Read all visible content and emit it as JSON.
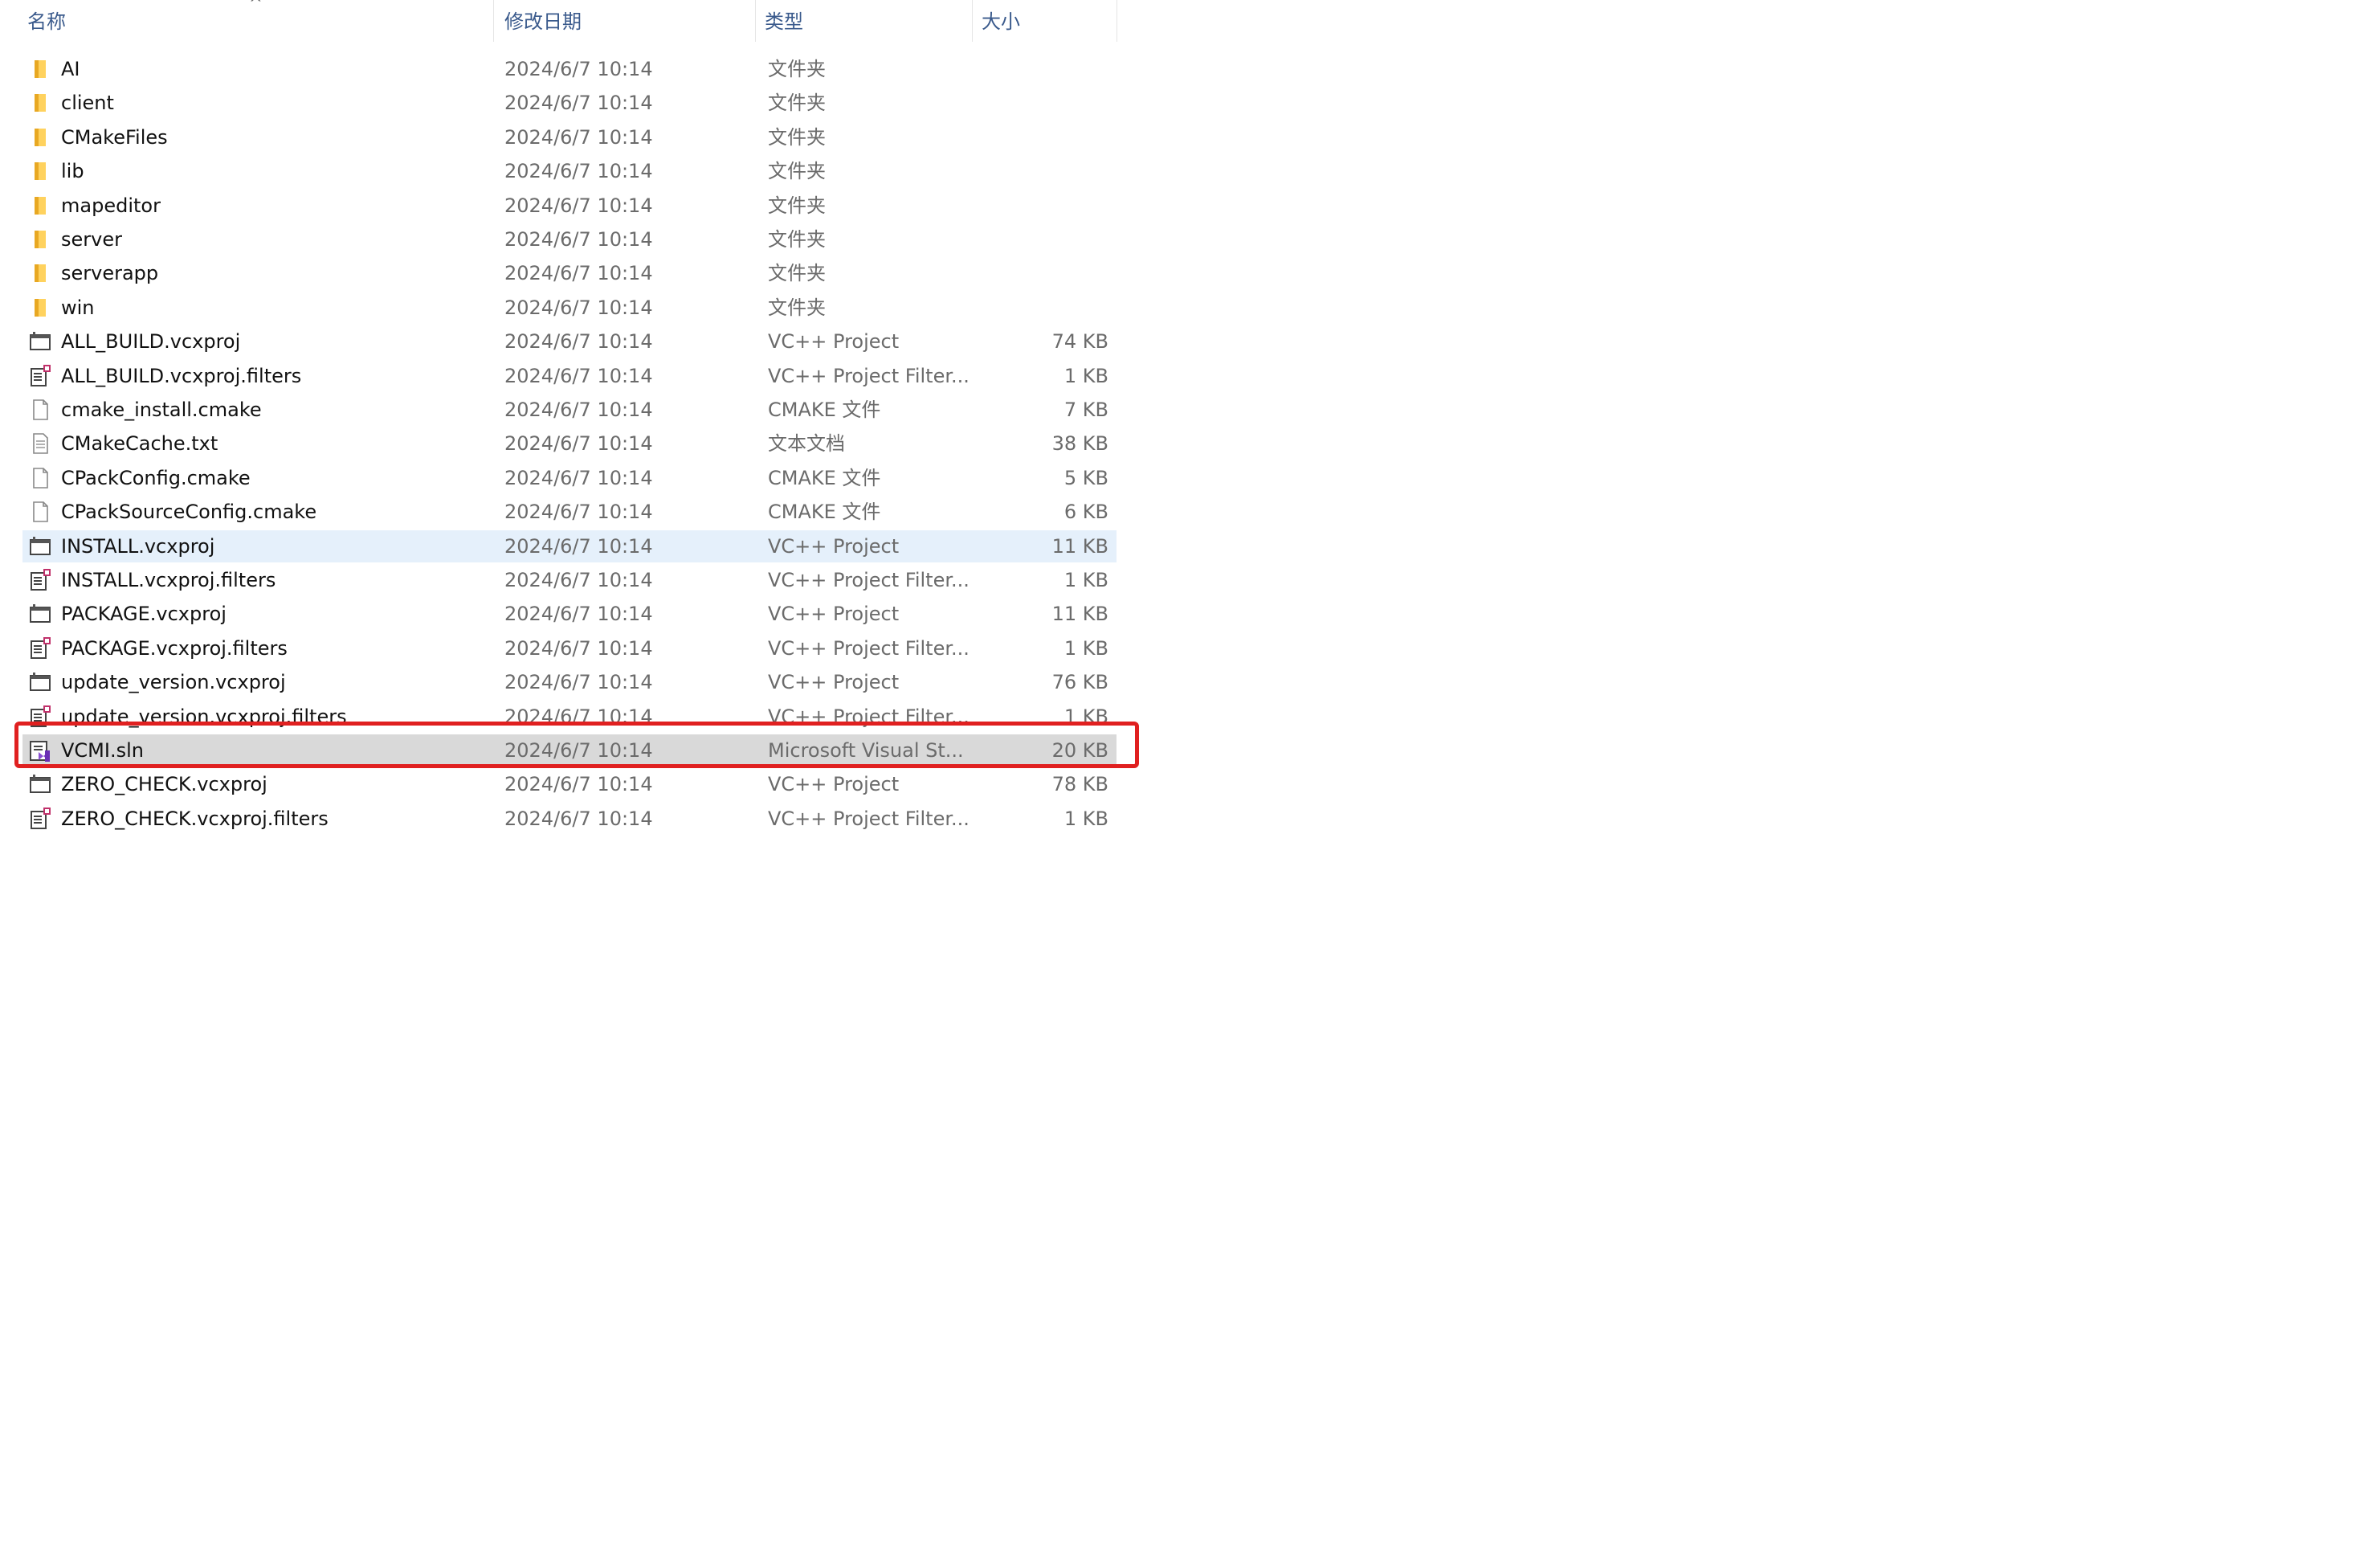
{
  "header": {
    "name": "名称",
    "date": "修改日期",
    "type": "类型",
    "size": "大小"
  },
  "files": [
    {
      "name": "AI",
      "date": "2024/6/7 10:14",
      "type": "文件夹",
      "size": "",
      "icon": "folder-icon"
    },
    {
      "name": "client",
      "date": "2024/6/7 10:14",
      "type": "文件夹",
      "size": "",
      "icon": "folder-icon"
    },
    {
      "name": "CMakeFiles",
      "date": "2024/6/7 10:14",
      "type": "文件夹",
      "size": "",
      "icon": "folder-icon"
    },
    {
      "name": "lib",
      "date": "2024/6/7 10:14",
      "type": "文件夹",
      "size": "",
      "icon": "folder-icon"
    },
    {
      "name": "mapeditor",
      "date": "2024/6/7 10:14",
      "type": "文件夹",
      "size": "",
      "icon": "folder-icon"
    },
    {
      "name": "server",
      "date": "2024/6/7 10:14",
      "type": "文件夹",
      "size": "",
      "icon": "folder-icon"
    },
    {
      "name": "serverapp",
      "date": "2024/6/7 10:14",
      "type": "文件夹",
      "size": "",
      "icon": "folder-icon"
    },
    {
      "name": "win",
      "date": "2024/6/7 10:14",
      "type": "文件夹",
      "size": "",
      "icon": "folder-icon"
    },
    {
      "name": "ALL_BUILD.vcxproj",
      "date": "2024/6/7 10:14",
      "type": "VC++ Project",
      "size": "74 KB",
      "icon": "vcxproj-icon"
    },
    {
      "name": "ALL_BUILD.vcxproj.filters",
      "date": "2024/6/7 10:14",
      "type": "VC++ Project Filter...",
      "size": "1 KB",
      "icon": "filters-icon"
    },
    {
      "name": "cmake_install.cmake",
      "date": "2024/6/7 10:14",
      "type": "CMAKE 文件",
      "size": "7 KB",
      "icon": "file-icon"
    },
    {
      "name": "CMakeCache.txt",
      "date": "2024/6/7 10:14",
      "type": "文本文档",
      "size": "38 KB",
      "icon": "text-file-icon"
    },
    {
      "name": "CPackConfig.cmake",
      "date": "2024/6/7 10:14",
      "type": "CMAKE 文件",
      "size": "5 KB",
      "icon": "file-icon"
    },
    {
      "name": "CPackSourceConfig.cmake",
      "date": "2024/6/7 10:14",
      "type": "CMAKE 文件",
      "size": "6 KB",
      "icon": "file-icon"
    },
    {
      "name": "INSTALL.vcxproj",
      "date": "2024/6/7 10:14",
      "type": "VC++ Project",
      "size": "11 KB",
      "icon": "vcxproj-icon",
      "state": "hover"
    },
    {
      "name": "INSTALL.vcxproj.filters",
      "date": "2024/6/7 10:14",
      "type": "VC++ Project Filter...",
      "size": "1 KB",
      "icon": "filters-icon"
    },
    {
      "name": "PACKAGE.vcxproj",
      "date": "2024/6/7 10:14",
      "type": "VC++ Project",
      "size": "11 KB",
      "icon": "vcxproj-icon"
    },
    {
      "name": "PACKAGE.vcxproj.filters",
      "date": "2024/6/7 10:14",
      "type": "VC++ Project Filter...",
      "size": "1 KB",
      "icon": "filters-icon"
    },
    {
      "name": "update_version.vcxproj",
      "date": "2024/6/7 10:14",
      "type": "VC++ Project",
      "size": "76 KB",
      "icon": "vcxproj-icon"
    },
    {
      "name": "update_version.vcxproj.filters",
      "date": "2024/6/7 10:14",
      "type": "VC++ Project Filter...",
      "size": "1 KB",
      "icon": "filters-icon"
    },
    {
      "name": "VCMI.sln",
      "date": "2024/6/7 10:14",
      "type": "Microsoft Visual St...",
      "size": "20 KB",
      "icon": "sln-icon",
      "state": "selected"
    },
    {
      "name": "ZERO_CHECK.vcxproj",
      "date": "2024/6/7 10:14",
      "type": "VC++ Project",
      "size": "78 KB",
      "icon": "vcxproj-icon"
    },
    {
      "name": "ZERO_CHECK.vcxproj.filters",
      "date": "2024/6/7 10:14",
      "type": "VC++ Project Filter...",
      "size": "1 KB",
      "icon": "filters-icon"
    }
  ],
  "colors": {
    "header_text": "#3a5a8c",
    "hover_row": "#e5f0fb",
    "selected_row": "#d9d9d9",
    "highlight_border": "#e02020"
  }
}
